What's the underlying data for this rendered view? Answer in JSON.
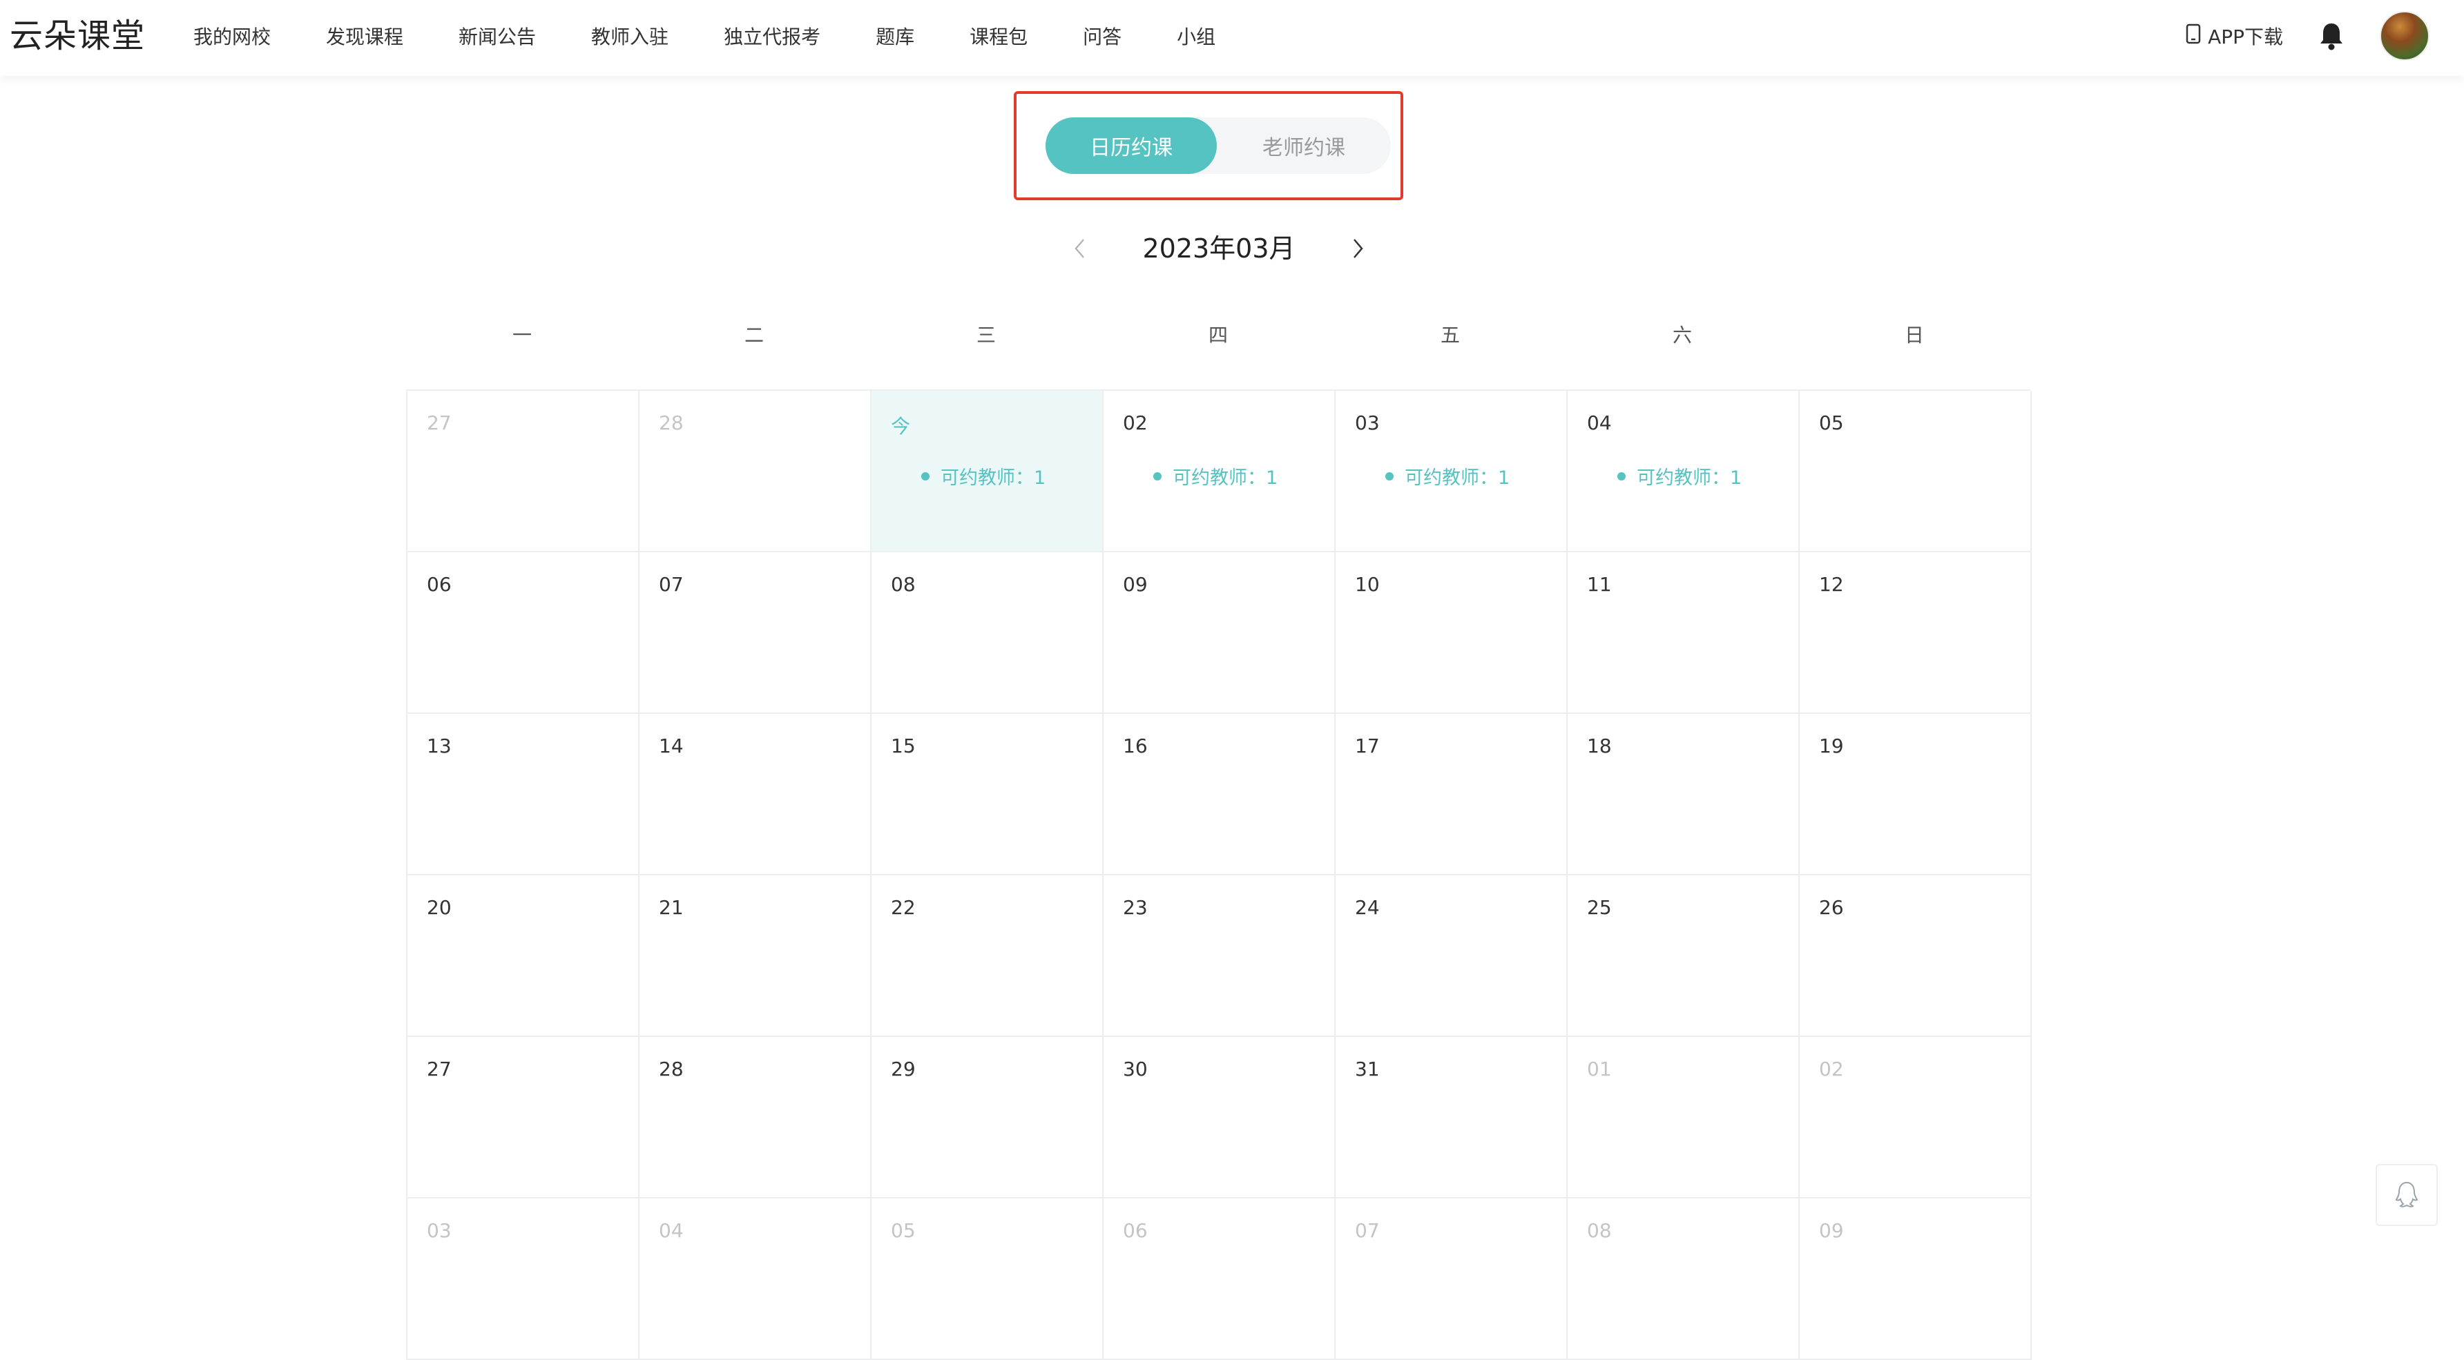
{
  "header": {
    "logo": "云朵课堂",
    "nav": [
      "我的网校",
      "发现课程",
      "新闻公告",
      "教师入驻",
      "独立代报考",
      "题库",
      "课程包",
      "问答",
      "小组"
    ],
    "app_download": "APP下载",
    "icons": {
      "phone": "phone-icon",
      "bell": "bell-icon",
      "avatar": "avatar"
    }
  },
  "toggle": {
    "active_label": "日历约课",
    "inactive_label": "老师约课",
    "active_color": "#56c3c3",
    "highlight_border_color": "#e33a2e"
  },
  "calendar": {
    "month_title": "2023年03月",
    "weekdays": [
      "一",
      "二",
      "三",
      "四",
      "五",
      "六",
      "日"
    ],
    "tag_label": "可约教师：1",
    "cells": [
      {
        "label": "27",
        "other": true
      },
      {
        "label": "28",
        "other": true
      },
      {
        "label": "今",
        "today": true,
        "tag": true
      },
      {
        "label": "02",
        "tag": true
      },
      {
        "label": "03",
        "tag": true
      },
      {
        "label": "04",
        "tag": true
      },
      {
        "label": "05"
      },
      {
        "label": "06"
      },
      {
        "label": "07"
      },
      {
        "label": "08"
      },
      {
        "label": "09"
      },
      {
        "label": "10"
      },
      {
        "label": "11"
      },
      {
        "label": "12"
      },
      {
        "label": "13"
      },
      {
        "label": "14"
      },
      {
        "label": "15"
      },
      {
        "label": "16"
      },
      {
        "label": "17"
      },
      {
        "label": "18"
      },
      {
        "label": "19"
      },
      {
        "label": "20"
      },
      {
        "label": "21"
      },
      {
        "label": "22"
      },
      {
        "label": "23"
      },
      {
        "label": "24"
      },
      {
        "label": "25"
      },
      {
        "label": "26"
      },
      {
        "label": "27"
      },
      {
        "label": "28"
      },
      {
        "label": "29"
      },
      {
        "label": "30"
      },
      {
        "label": "31"
      },
      {
        "label": "01",
        "other": true
      },
      {
        "label": "02",
        "other": true
      },
      {
        "label": "03",
        "other": true
      },
      {
        "label": "04",
        "other": true
      },
      {
        "label": "05",
        "other": true
      },
      {
        "label": "06",
        "other": true
      },
      {
        "label": "07",
        "other": true
      },
      {
        "label": "08",
        "other": true
      },
      {
        "label": "09",
        "other": true
      }
    ]
  },
  "float_button": {
    "icon": "qq-icon"
  }
}
